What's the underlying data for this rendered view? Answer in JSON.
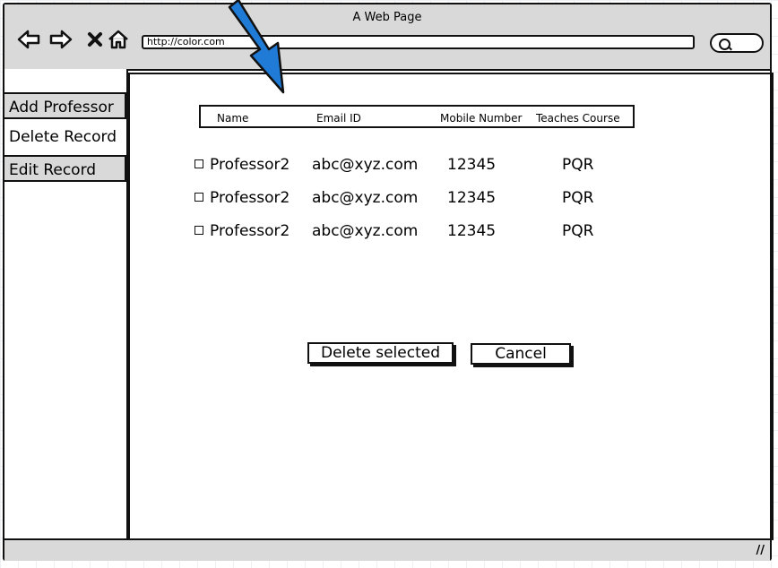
{
  "window": {
    "title": "A Web Page",
    "url": "http://color.com"
  },
  "sidebar": {
    "items": [
      {
        "label": "Add Professor"
      },
      {
        "label": "Delete Record"
      },
      {
        "label": "Edit Record"
      }
    ]
  },
  "table": {
    "headers": [
      "Name",
      "Email ID",
      "Mobile Number",
      "Teaches Course"
    ],
    "rows": [
      {
        "name": "Professor2",
        "email": "abc@xyz.com",
        "mobile": "12345",
        "course": "PQR"
      },
      {
        "name": "Professor2",
        "email": "abc@xyz.com",
        "mobile": "12345",
        "course": "PQR"
      },
      {
        "name": "Professor2",
        "email": "abc@xyz.com",
        "mobile": "12345",
        "course": "PQR"
      }
    ]
  },
  "actions": {
    "delete_label": "Delete selected",
    "cancel_label": "Cancel"
  },
  "colors": {
    "chrome": "#d9d9d9",
    "arrow": "#1f7bd6",
    "outline": "#111111"
  },
  "icons": {
    "back": "back-arrow-icon",
    "forward": "forward-arrow-icon",
    "stop": "close-icon",
    "home": "home-icon",
    "search": "search-icon",
    "resize": "resize-grip-icon"
  }
}
